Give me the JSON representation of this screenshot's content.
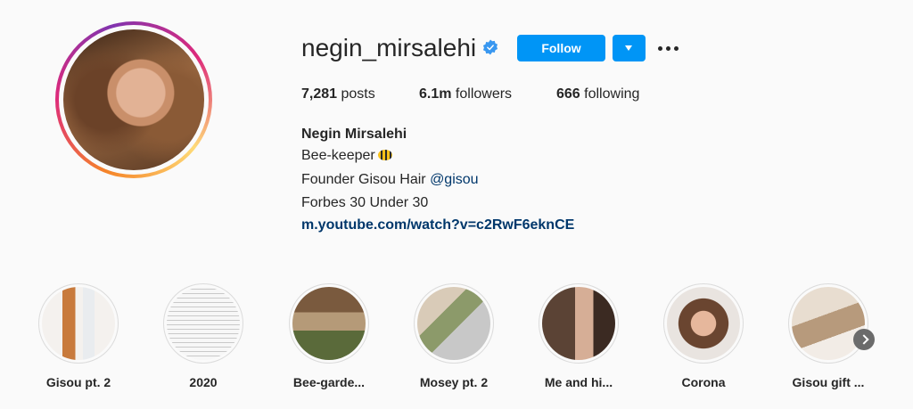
{
  "profile": {
    "username": "negin_mirsalehi",
    "verified_icon": "verified-badge-icon",
    "follow_label": "Follow",
    "dropdown_icon": "chevron-down-icon",
    "more_icon": "more-options-icon"
  },
  "stats": {
    "posts_count": "7,281",
    "posts_label": "posts",
    "followers_count": "6.1m",
    "followers_label": "followers",
    "following_count": "666",
    "following_label": "following"
  },
  "bio": {
    "full_name": "Negin Mirsalehi",
    "line1": "Bee-keeper",
    "line1_emoji_icon": "bee-icon",
    "line2_prefix": "Founder Gisou Hair ",
    "line2_mention": "@gisou",
    "line3": "Forbes 30 Under 30",
    "link": "m.youtube.com/watch?v=c2RwF6eknCE"
  },
  "highlights": [
    {
      "label": "Gisou pt. 2"
    },
    {
      "label": "2020"
    },
    {
      "label": "Bee-garde..."
    },
    {
      "label": "Mosey pt. 2"
    },
    {
      "label": "Me and hi..."
    },
    {
      "label": "Corona"
    },
    {
      "label": "Gisou gift ..."
    }
  ],
  "colors": {
    "accent": "#0095f6",
    "link": "#00376b",
    "text": "#262626",
    "background": "#fafafa"
  }
}
